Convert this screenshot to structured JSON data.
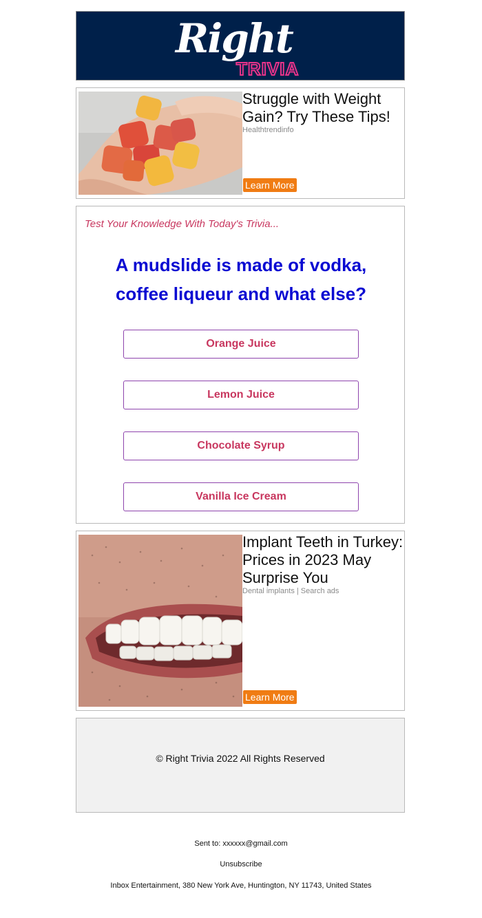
{
  "header": {
    "logo_script": "Right",
    "logo_trivia": "TRIVIA"
  },
  "ads": [
    {
      "title": "Struggle with Weight Gain? Try These Tips!",
      "source": "Healthtrendinfo",
      "cta": "Learn More",
      "image": "gummies-in-hand-photo"
    },
    {
      "title": "Implant Teeth in Turkey: Prices in 2023 May Surprise You",
      "source": "Dental implants | Search ads",
      "cta": "Learn More",
      "image": "smiling-teeth-photo"
    }
  ],
  "trivia": {
    "intro": "Test Your Knowledge With Today's Trivia...",
    "question": "A mudslide is made of vodka, coffee liqueur and what else?",
    "answers": [
      "Orange Juice",
      "Lemon Juice",
      "Chocolate Syrup",
      "Vanilla Ice Cream"
    ]
  },
  "footer": {
    "copyright": "© Right Trivia 2022 All Rights Reserved",
    "sent_to_label": "Sent to: ",
    "sent_to_email": "xxxxxx@gmail.com",
    "unsubscribe": "Unsubscribe",
    "address": "Inbox Entertainment, 380 New York Ave, Huntington, NY 11743, United States"
  },
  "colors": {
    "header_bg": "#00204a",
    "logo_accent": "#e8338a",
    "question": "#0a0ad2",
    "answer_text": "#c8375f",
    "answer_border": "#8e44ad",
    "cta_bg": "#f07c13",
    "footer_bg": "#f1f1f1"
  }
}
